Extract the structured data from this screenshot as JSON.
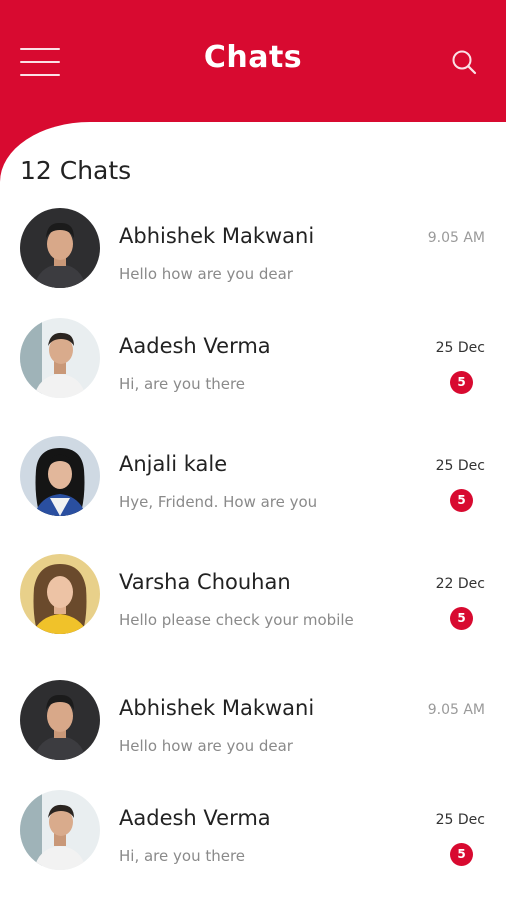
{
  "header": {
    "title": "Chats",
    "menu_icon": "hamburger-menu-icon",
    "search_icon": "search-icon"
  },
  "colors": {
    "brand": "#d80a30",
    "background": "#ffffff",
    "name_text": "#222222",
    "message_text": "#8a8a8a"
  },
  "chat_count": "12 Chats",
  "chats": [
    {
      "name": "Abhishek Makwani",
      "message": "Hello how are you dear",
      "time": "9.05 AM",
      "unread": null
    },
    {
      "name": "Aadesh Verma",
      "message": "Hi, are you there",
      "time": "25 Dec",
      "unread": "5"
    },
    {
      "name": "Anjali kale",
      "message": "Hye, Fridend. How are you",
      "time": "25 Dec",
      "unread": "5"
    },
    {
      "name": "Varsha Chouhan",
      "message": "Hello please check your mobile",
      "time": "22 Dec",
      "unread": "5"
    },
    {
      "name": "Abhishek Makwani",
      "message": "Hello how are you dear",
      "time": "9.05 AM",
      "unread": null
    },
    {
      "name": "Aadesh Verma",
      "message": "Hi, are you there",
      "time": "25 Dec",
      "unread": "5"
    }
  ]
}
